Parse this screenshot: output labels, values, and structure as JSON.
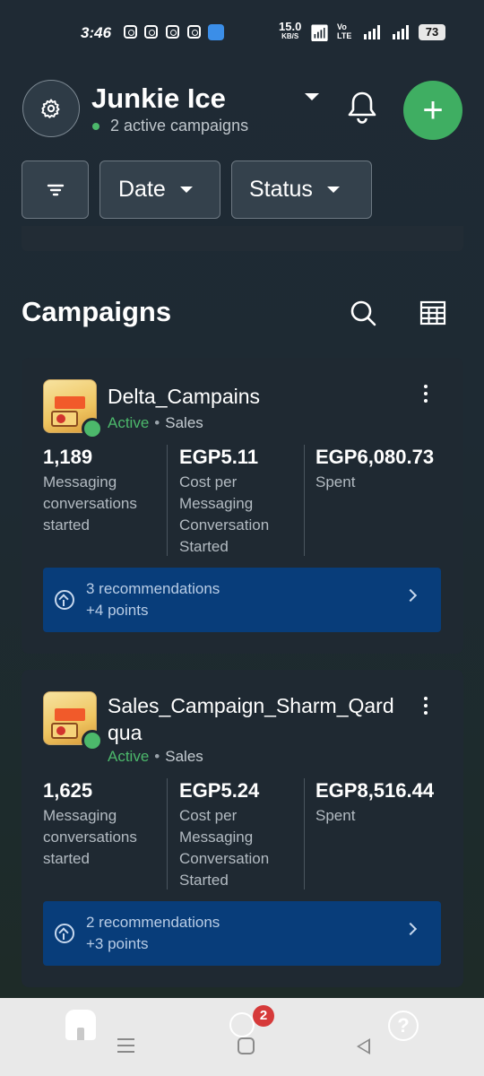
{
  "status_bar": {
    "time": "3:46",
    "network_speed": "15.0",
    "network_unit": "KB/S",
    "volte_top": "Vo",
    "volte_bottom": "LTE",
    "battery": "73"
  },
  "header": {
    "account_name": "Junkie Ice",
    "subtitle": "2 active campaigns",
    "add_label": "+"
  },
  "filters": {
    "date_label": "Date",
    "status_label": "Status"
  },
  "campaigns_section": {
    "title": "Campaigns"
  },
  "campaigns": [
    {
      "name": "Delta_Campains",
      "status": "Active",
      "separator": "•",
      "objective": "Sales",
      "metrics": [
        {
          "value": "1,189",
          "label": "Messaging conversations started"
        },
        {
          "value": "EGP5.11",
          "label": "Cost per Messaging Conversation Started"
        },
        {
          "value": "EGP6,080.73",
          "label": "Spent"
        }
      ],
      "recommendations": "3 recommendations",
      "points": "+4 points"
    },
    {
      "name": "Sales_Campaign_Sharm_Qardqua",
      "status": "Active",
      "separator": "•",
      "objective": "Sales",
      "metrics": [
        {
          "value": "1,625",
          "label": "Messaging conversations started"
        },
        {
          "value": "EGP5.24",
          "label": "Cost per Messaging Conversation Started"
        },
        {
          "value": "EGP8,516.44",
          "label": "Spent"
        }
      ],
      "recommendations": "2 recommendations",
      "points": "+3 points"
    }
  ],
  "bottom_nav": {
    "notifications_badge": "2",
    "help_label": "?"
  },
  "colors": {
    "accent_green": "#3fae62",
    "active_status": "#4cb86b",
    "recommendation_bg": "#083d7a",
    "badge_red": "#d63a3a"
  },
  "icons": [
    "settings-gear-icon",
    "bell-icon",
    "filter-icon",
    "search-icon",
    "table-icon",
    "more-vertical-icon",
    "arrow-up-circle-icon",
    "chevron-right-icon",
    "home-icon",
    "lightbulb-icon",
    "help-icon"
  ]
}
